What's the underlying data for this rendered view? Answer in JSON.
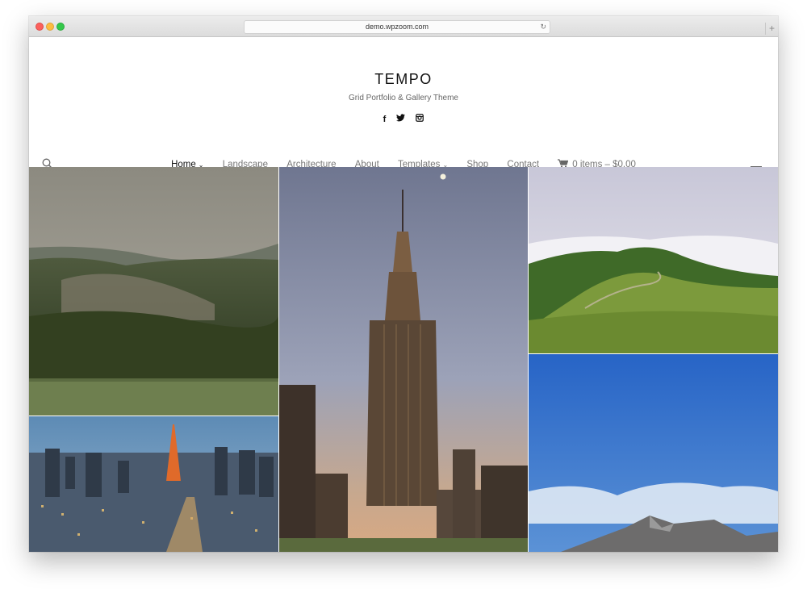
{
  "browser": {
    "url": "demo.wpzoom.com",
    "reload_icon": "reload-icon",
    "new_tab_icon": "plus-icon"
  },
  "site": {
    "title": "TEMPO",
    "tagline": "Grid Portfolio & Gallery Theme",
    "social": [
      "facebook-icon",
      "twitter-icon",
      "instagram-icon"
    ]
  },
  "nav": {
    "items": [
      {
        "label": "Home",
        "active": true,
        "has_dropdown": true
      },
      {
        "label": "Landscape"
      },
      {
        "label": "Architecture"
      },
      {
        "label": "About"
      },
      {
        "label": "Templates",
        "has_dropdown": true
      },
      {
        "label": "Shop"
      },
      {
        "label": "Contact"
      }
    ],
    "cart": "0 items – $0.00"
  },
  "gallery": [
    {
      "subject": "forest hills landscape"
    },
    {
      "subject": "Tokyo city at dusk"
    },
    {
      "subject": "Empire State Building"
    },
    {
      "subject": "green hill with fog"
    },
    {
      "subject": "blue sky over mountains"
    }
  ],
  "colors": {
    "accent": "#111111",
    "nav_text": "#777777"
  }
}
